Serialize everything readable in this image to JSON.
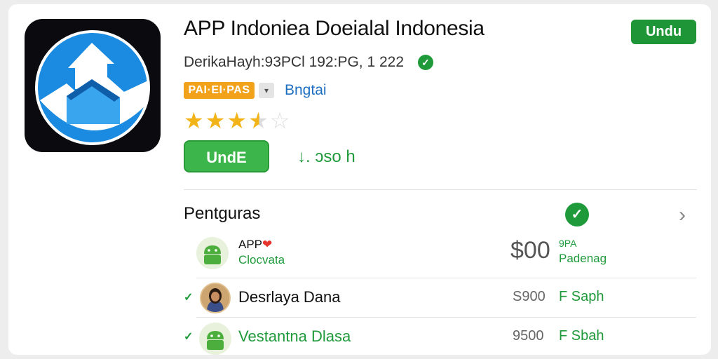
{
  "app": {
    "title": "APP Indoniea Doeialal Indonesia",
    "developer": "DerikaHayh:93PCl 192:PG, 1 222",
    "badge": "PAI·EI·PAS",
    "category": "Bngtai",
    "rating": 3.5,
    "rating_max": 5,
    "top_button": "Undu",
    "install_button": "UndE",
    "size": "↓. ɔso h"
  },
  "colors": {
    "accent_green": "#1e9638",
    "badge_orange": "#f2a21a",
    "link_blue": "#1f6fc0",
    "star_gold": "#f2b418"
  },
  "section": {
    "title": "Pentguras"
  },
  "rows": [
    {
      "name": "APP",
      "subtitle": "Clocvata",
      "price": "$00",
      "tag_line1": "9PA",
      "tag_line2": "Padenag"
    },
    {
      "name": "Desrlaya Dana",
      "price": "S900",
      "tag": "F Saph"
    },
    {
      "name": "Vestantna Dlasa",
      "price": "9500",
      "tag": "F Sbah"
    }
  ]
}
